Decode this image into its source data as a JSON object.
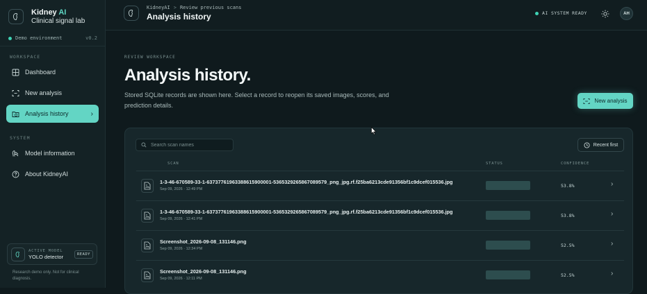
{
  "brand": {
    "name": "Kidney",
    "name_accent": "AI",
    "subtitle": "Clinical signal lab",
    "logo_icon": "kidney-icon"
  },
  "environment": {
    "label": "Demo environment",
    "version": "v0.2"
  },
  "sidebar": {
    "workspace_label": "WORKSPACE",
    "workspace_items": [
      {
        "label": "Dashboard",
        "icon": "grid-icon"
      },
      {
        "label": "New analysis",
        "icon": "scan-icon"
      },
      {
        "label": "Analysis history",
        "icon": "history-icon",
        "active": true
      }
    ],
    "system_label": "SYSTEM",
    "system_items": [
      {
        "label": "Model information",
        "icon": "model-icon"
      },
      {
        "label": "About KidneyAI",
        "icon": "help-icon"
      }
    ],
    "model_card": {
      "label": "ACTIVE MODEL",
      "name": "YOLO detector",
      "status": "READY"
    },
    "footnote": "Research demo only. Not for clinical diagnosis."
  },
  "topbar": {
    "breadcrumb_root": "KidneyAI",
    "breadcrumb_sep": ">",
    "breadcrumb_current": "Review previous scans",
    "title": "Analysis history",
    "system_status": "AI SYSTEM READY",
    "avatar_initials": "AH"
  },
  "main": {
    "eyebrow": "REVIEW WORKSPACE",
    "title": "Analysis history.",
    "description": "Stored SQLite records are shown here. Select a record to reopen its saved images, scores, and prediction details.",
    "new_analysis_label": "New analysis"
  },
  "history": {
    "search_placeholder": "Search scan names",
    "sort_label": "Recent first",
    "columns": {
      "scan": "SCAN",
      "status": "STATUS",
      "confidence": "CONFIDENCE"
    },
    "rows": [
      {
        "name": "1-3-46-670589-33-1-63737761963388615900001-5365329265867089579_png_jpg.rf.f25ba6213cde91356bf1c9dcef015536.jpg",
        "date": "Sep 09, 2026 · 12:49 PM",
        "confidence": "53.8%"
      },
      {
        "name": "1-3-46-670589-33-1-63737761963388615900001-5365329265867089579_png_jpg.rf.f25ba6213cde91356bf1c9dcef015536.jpg",
        "date": "Sep 09, 2026 · 12:41 PM",
        "confidence": "53.8%"
      },
      {
        "name": "Screenshot_2026-09-08_131146.png",
        "date": "Sep 09, 2026 · 12:34 PM",
        "confidence": "52.5%"
      },
      {
        "name": "Screenshot_2026-09-08_131146.png",
        "date": "Sep 09, 2026 · 12:11 PM",
        "confidence": "52.5%"
      }
    ]
  },
  "colors": {
    "accent": "#63d5c4",
    "background": "#0f1a1d",
    "panel": "#17272b",
    "status_dot": "#3fd2b4"
  }
}
